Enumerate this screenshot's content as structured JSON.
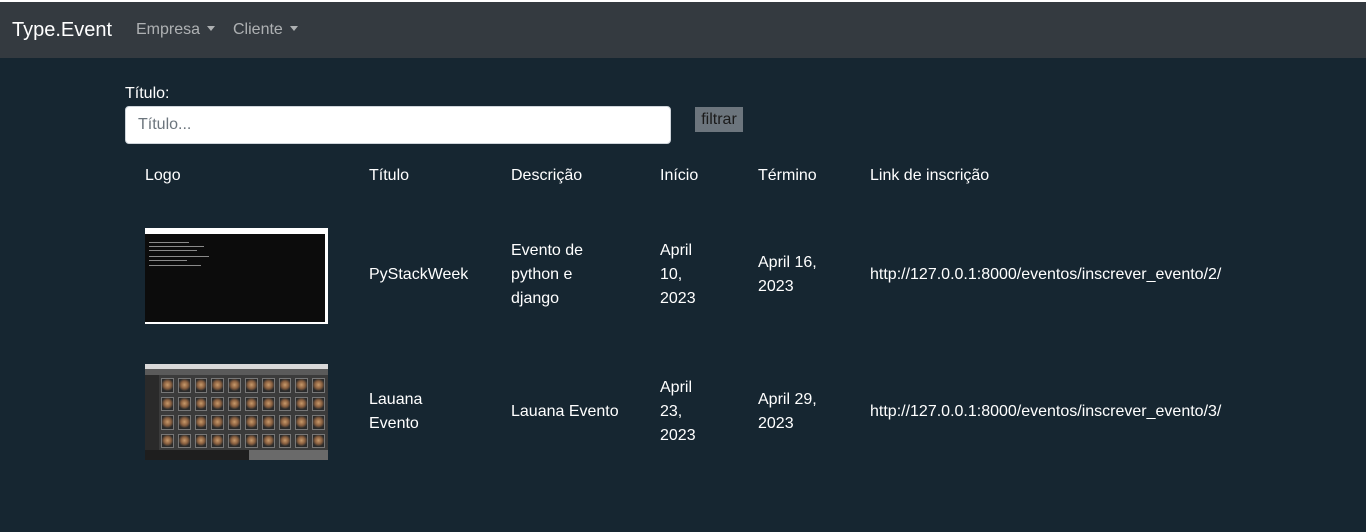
{
  "navbar": {
    "brand": "Type.Event",
    "menus": [
      {
        "label": "Empresa"
      },
      {
        "label": "Cliente"
      }
    ]
  },
  "filter": {
    "label": "Título:",
    "placeholder": "Título...",
    "value": "",
    "button_label": "filtrar"
  },
  "table": {
    "headers": [
      "Logo",
      "Título",
      "Descrição",
      "Início",
      "Término",
      "Link de inscrição"
    ],
    "rows": [
      {
        "logo_icon": "terminal-screenshot-thumbnail",
        "titulo": "PyStackWeek",
        "descricao": "Evento de python e django",
        "inicio": "April 10, 2023",
        "termino": "April 16, 2023",
        "link": "http://127.0.0.1:8000/eventos/inscrever_evento/2/"
      },
      {
        "logo_icon": "photo-grid-screenshot-thumbnail",
        "titulo": "Lauana Evento",
        "descricao": "Lauana Evento",
        "inicio": "April 23, 2023",
        "termino": "April 29, 2023",
        "link": "http://127.0.0.1:8000/eventos/inscrever_evento/3/"
      }
    ]
  },
  "colors": {
    "page_background": "#162631",
    "navbar_background": "#343a40",
    "button_background": "#6c757d"
  }
}
